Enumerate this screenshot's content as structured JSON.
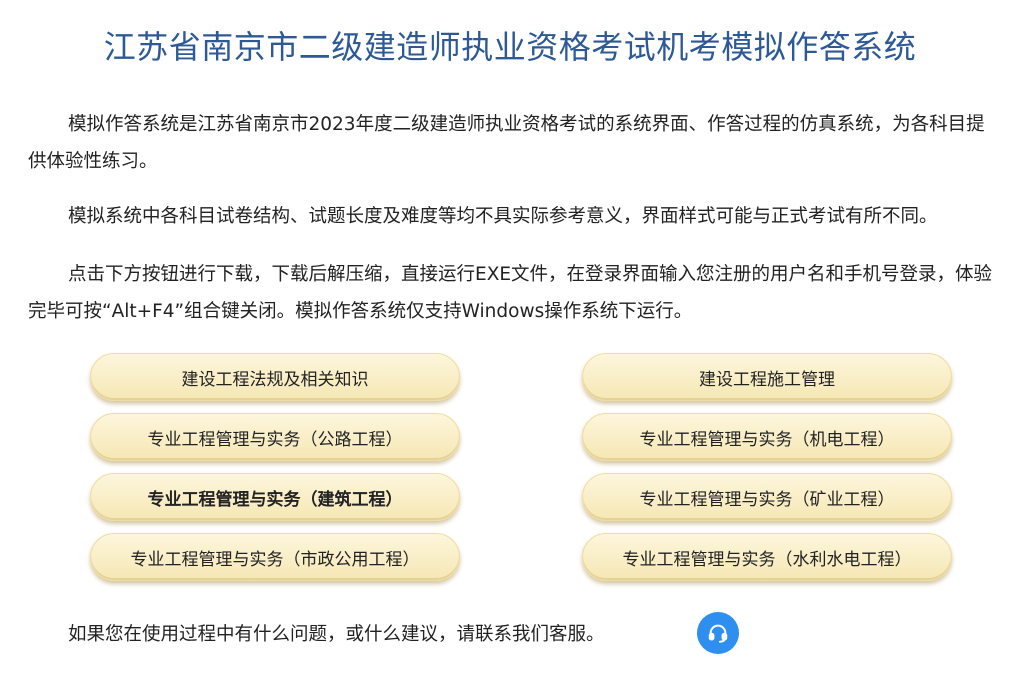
{
  "title": "江苏省南京市二级建造师执业资格考试机考模拟作答系统",
  "paragraphs": {
    "p1": "模拟作答系统是江苏省南京市2023年度二级建造师执业资格考试的系统界面、作答过程的仿真系统，为各科目提供体验性练习。",
    "p2": "模拟系统中各科目试卷结构、试题长度及难度等均不具实际参考意义，界面样式可能与正式考试有所不同。",
    "p3": "点击下方按钮进行下载，下载后解压缩，直接运行EXE文件，在登录界面输入您注册的用户名和手机号登录，体验完毕可按“Alt+F4”组合键关闭。模拟作答系统仅支持Windows操作系统下运行。"
  },
  "buttons": {
    "b0": "建设工程法规及相关知识",
    "b1": "建设工程施工管理",
    "b2": "专业工程管理与实务（公路工程）",
    "b3": "专业工程管理与实务（机电工程）",
    "b4": "专业工程管理与实务（建筑工程）",
    "b5": "专业工程管理与实务（矿业工程）",
    "b6": "专业工程管理与实务（市政公用工程）",
    "b7": "专业工程管理与实务（水利水电工程）"
  },
  "footer": "如果您在使用过程中有什么问题，或什么建议，请联系我们客服。",
  "icons": {
    "support": "headset-icon"
  },
  "colors": {
    "title": "#2d5a96",
    "button_bg": "#f5e7b4",
    "support_bg": "#2f8ff0"
  }
}
